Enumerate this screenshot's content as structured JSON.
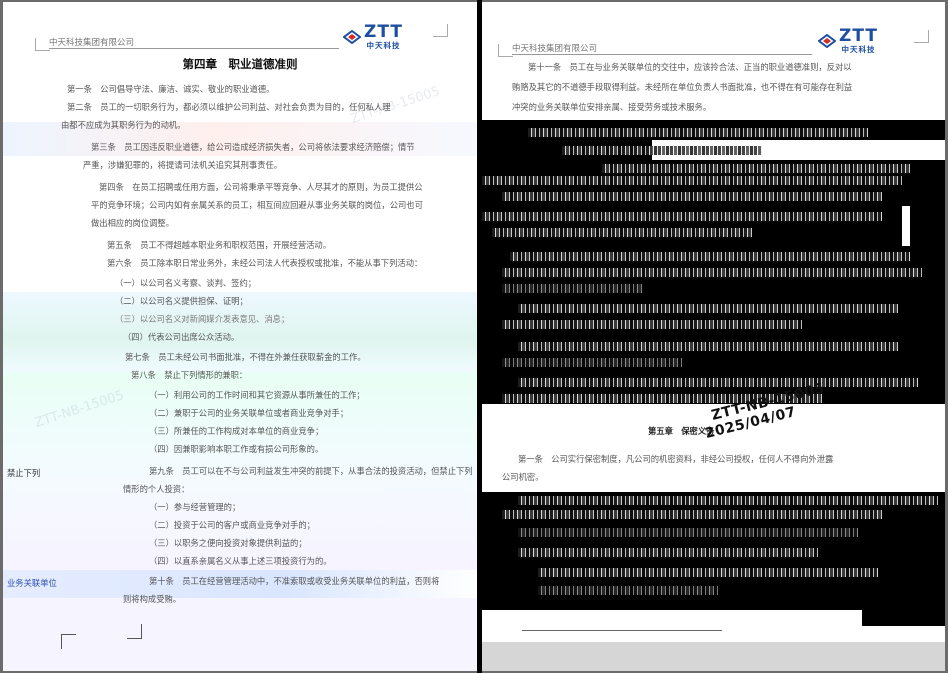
{
  "header": {
    "company": "中天科技集团有限公司",
    "logo_brand": "ZTT",
    "logo_cn": "中天科技"
  },
  "left_page": {
    "chapter_title": "第四章　职业道德准则",
    "lines": [
      "第一条　公司倡导守法、廉洁、诚实、敬业的职业道德。",
      "第二条　员工的一切职务行为，都必须以维护公司利益、对社会负责为目的，任何私人理",
      "由都不应成为其职务行为的动机。",
      "第三条　员工因违反职业道德，给公司造成经济损失者，公司将依法要求经济赔偿；情节",
      "严重，涉嫌犯罪的，将提请司法机关追究其刑事责任。",
      "第四条　在员工招聘或任用方面，公司将秉承平等竞争、人尽其才的原则，为员工提供公",
      "平的竞争环境；公司内如有亲属关系的员工，相互间应回避从事业务关联的岗位，公司也可",
      "做出相应的岗位调整。",
      "第五条　员工不得超越本职业务和职权范围，开展经营活动。",
      "第六条　员工除本职日常业务外，未经公司法人代表授权或批准，不能从事下列活动：",
      "（一）以公司名义考察、谈判、签约；",
      "（二）以公司名义提供担保、证明；",
      "（三）以公司名义对新闻媒介发表意见、消息；",
      "（四）代表公司出席公众活动。",
      "第七条　员工未经公司书面批准，不得在外兼任获取薪金的工作。",
      "第八条　禁止下列情形的兼职：",
      "（一）利用公司的工作时间和其它资源从事所兼任的工作；",
      "（二）兼职于公司的业务关联单位或者商业竞争对手；",
      "（三）所兼任的工作构成对本单位的商业竞争；",
      "（四）因兼职影响本职工作或有损公司形象的。",
      "第九条　员工可以在不与公司利益发生冲突的前提下，从事合法的投资活动，但禁止下列",
      "情形的个人投资：",
      "（一）参与经营管理的；",
      "（二）投资于公司的客户或商业竞争对手的；",
      "（三）以职务之便向投资对象提供利益的；",
      "（四）以直系亲属名义从事上述三项投资行为的。",
      "第十条　员工在经营管理活动中，不准索取或收受业务关联单位的利益，否则将",
      "则将构成受贿。"
    ],
    "margin_note_1": "禁止下列",
    "margin_note_2": "业务关联单位"
  },
  "right_page": {
    "lines": [
      "第十一条　员工在与业务关联单位的交往中，应该拎合法、正当的职业道德准则，反对以",
      "贿赂及其它的不道德手段取得利益。未经所在单位负责人书面批准，也不得在有可能存在利益",
      "冲突的业务关联单位安排亲属、接受劳务或技术服务。"
    ],
    "section_heading": "第五章　保密义务",
    "rule_line_1": "第一条　公司实行保密制度，凡公司的机密资料，非经公司授权，任何人不得向外泄露",
    "rule_line_2": "公司机密。",
    "stamp_code": "ZTT-NB-15005",
    "stamp_date": "2025/04/07"
  },
  "watermark": "ZTT-NB-15005"
}
